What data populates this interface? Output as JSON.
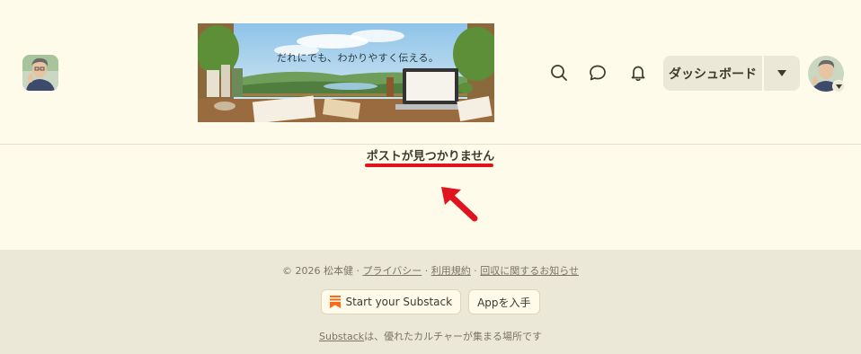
{
  "header": {
    "banner_text": "だれにでも、わかりやすく伝える。",
    "dashboard_label": "ダッシュボード",
    "icons": [
      "search-icon",
      "chat-icon",
      "bell-icon",
      "caret-down-icon"
    ]
  },
  "main": {
    "not_found_text": "ポストが見つかりません",
    "annotation_color": "#e0141e"
  },
  "footer": {
    "copyright_prefix": "© 2026 松本健 · ",
    "privacy_label": "プライバシー",
    "sep1": " · ",
    "terms_label": "利用規約",
    "sep2": " · ",
    "collection_label": "回収に関するお知らせ",
    "start_substack_label": "Start your Substack",
    "app_label": "Appを入手",
    "substack_link": "Substack",
    "tagline_rest": "は、優れたカルチャーが集まる場所です",
    "accent_color": "#ff6719"
  }
}
